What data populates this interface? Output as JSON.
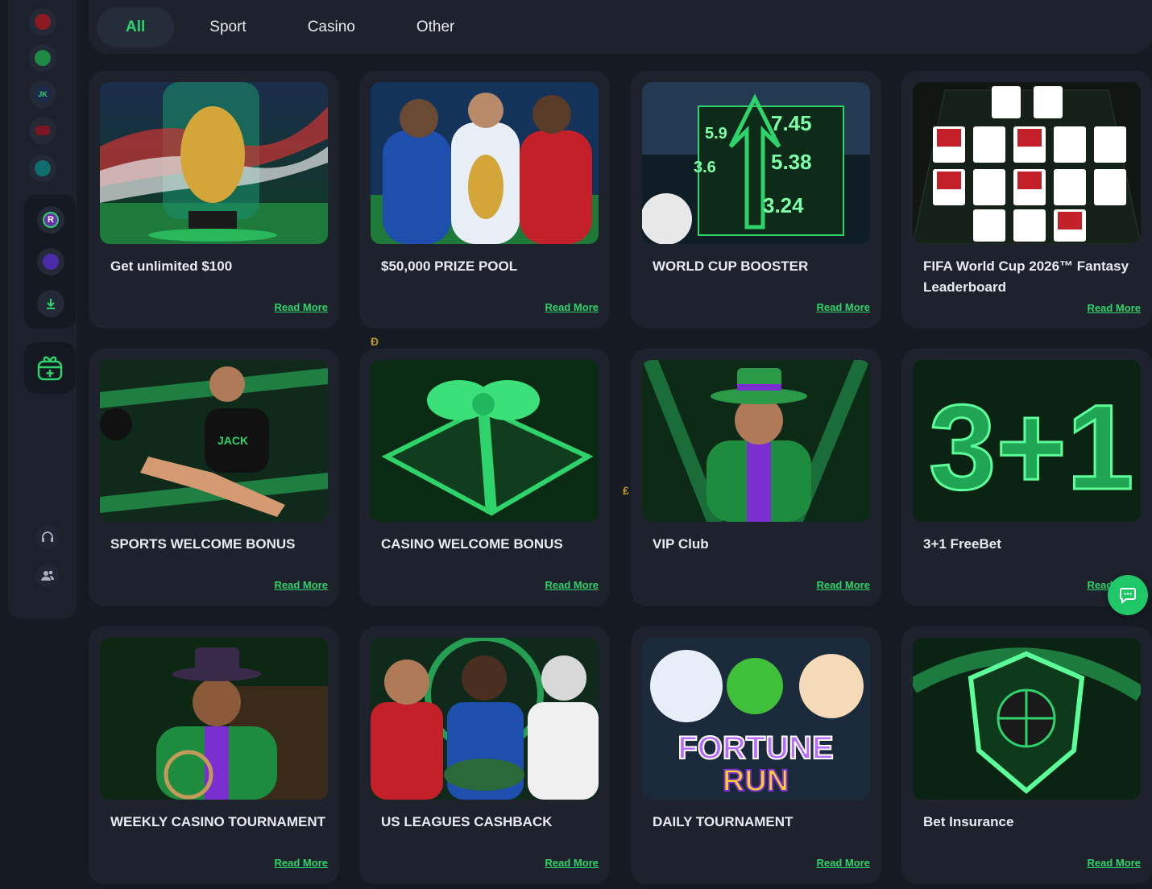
{
  "tabs": [
    {
      "label": "All",
      "active": true
    },
    {
      "label": "Sport",
      "active": false
    },
    {
      "label": "Casino",
      "active": false
    },
    {
      "label": "Other",
      "active": false
    }
  ],
  "sidebar": {
    "icons": [
      "poker-chip-icon",
      "soccer-icon",
      "jack-logo-icon",
      "cards-icon",
      "rocket-icon"
    ],
    "group_icons": [
      "r-coin-icon",
      "hexagon-icon",
      "download-icon"
    ],
    "promotions_icon": "gift-plus-icon",
    "bottom_icons": [
      "headset-icon",
      "users-icon"
    ],
    "group_letter": "R"
  },
  "cards": [
    {
      "title": "Get unlimited $100",
      "more": "Read More"
    },
    {
      "title": "$50,000 PRIZE POOL",
      "more": "Read More"
    },
    {
      "title": "WORLD CUP BOOSTER",
      "more": "Read More"
    },
    {
      "title": "FIFA World Cup 2026™ Fantasy Leaderboard",
      "more": "Read More"
    },
    {
      "title": "SPORTS WELCOME BONUS",
      "more": "Read More"
    },
    {
      "title": "CASINO WELCOME BONUS",
      "more": "Read More"
    },
    {
      "title": "VIP Club",
      "more": "Read More"
    },
    {
      "title": "3+1 FreeBet",
      "more": "Read More"
    },
    {
      "title": "WEEKLY CASINO TOURNAMENT",
      "more": "Read More"
    },
    {
      "title": "US LEAGUES CASHBACK",
      "more": "Read More"
    },
    {
      "title": "DAILY TOURNAMENT",
      "more": "Read More"
    },
    {
      "title": "Bet Insurance",
      "more": "Read More"
    }
  ],
  "booster_odds": [
    "7.45",
    "5.38",
    "3.24",
    "5.9",
    "3.6"
  ],
  "fortune_run": {
    "line1": "FORTUNE",
    "line2": "RUN"
  },
  "jersey_text": "JACK",
  "freebet_text": "3+1",
  "coins": [
    "Ð",
    "₤"
  ],
  "colors": {
    "accent": "#2fd36b",
    "card_bg": "#1d222d",
    "page_bg": "#161a23"
  },
  "chat_icon": "chat-bubble-icon"
}
